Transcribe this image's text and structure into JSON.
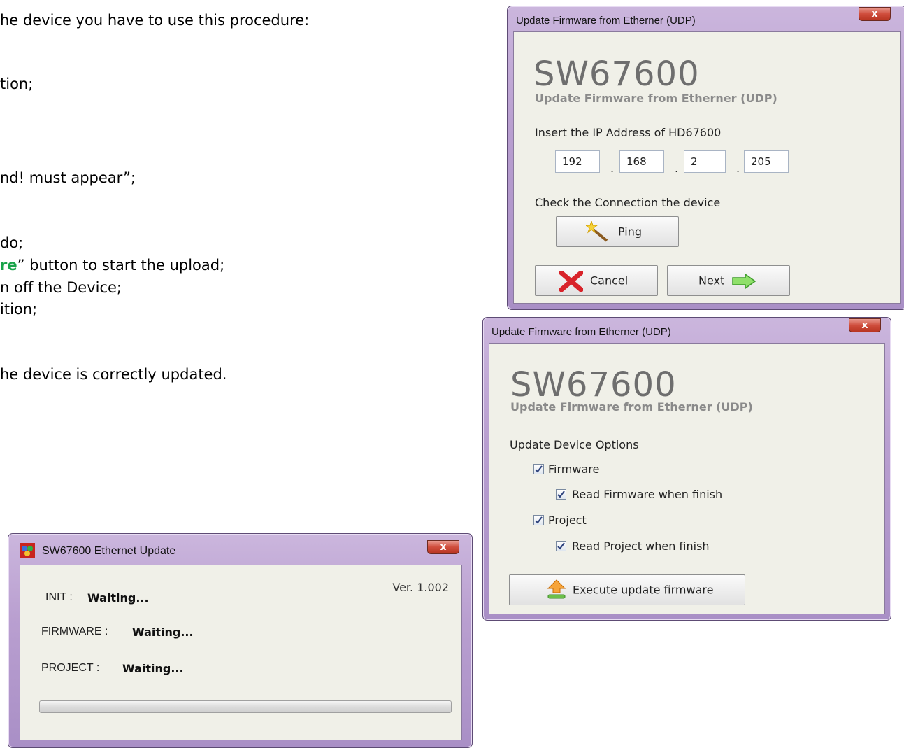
{
  "document": {
    "lines": [
      {
        "text": "he device you have to use this procedure:"
      },
      {
        "text": "tion;"
      },
      {
        "text": "nd! must appear”;"
      },
      {
        "text": "do;"
      },
      {
        "pre": "",
        "highlight": "re",
        "post": "” button to start the upload;"
      },
      {
        "text": "n off the Device;"
      },
      {
        "text": "ition;"
      },
      {
        "text": "he device is correctly updated."
      }
    ],
    "highlight_color": "#1aa34a"
  },
  "window1": {
    "title": "Update Firmware from Etherner (UDP)",
    "close_label": "x",
    "product": "SW67600",
    "subtitle": "Update Firmware from Etherner (UDP)",
    "ip_label": "Insert the IP Address of HD67600",
    "ip": [
      "192",
      "168",
      "2",
      "205"
    ],
    "ip_separator": ".",
    "check_label": "Check the Connection the device",
    "ping_label": "Ping",
    "cancel_label": "Cancel",
    "next_label": "Next"
  },
  "window2": {
    "title": "Update Firmware from Etherner (UDP)",
    "close_label": "x",
    "product": "SW67600",
    "subtitle": "Update Firmware from Etherner (UDP)",
    "options_label": "Update Device Options",
    "options": {
      "firmware": {
        "label": "Firmware",
        "checked": true
      },
      "read_firmware": {
        "label": "Read Firmware when finish",
        "checked": true
      },
      "project": {
        "label": "Project",
        "checked": true
      },
      "read_project": {
        "label": "Read Project when finish",
        "checked": true
      }
    },
    "execute_label": "Execute update firmware"
  },
  "window3": {
    "title": "SW67600 Ethernet Update",
    "close_label": "x",
    "version": "Ver. 1.002",
    "init_label": "INIT :",
    "init_value": "Waiting...",
    "firmware_label": "FIRMWARE :",
    "firmware_value": "Waiting...",
    "project_label": "PROJECT :",
    "project_value": "Waiting...",
    "progress": 0
  },
  "colors": {
    "window_frame": "#b99fd0",
    "close_button": "#cf4d3c",
    "client_bg": "#f0f0e8"
  }
}
